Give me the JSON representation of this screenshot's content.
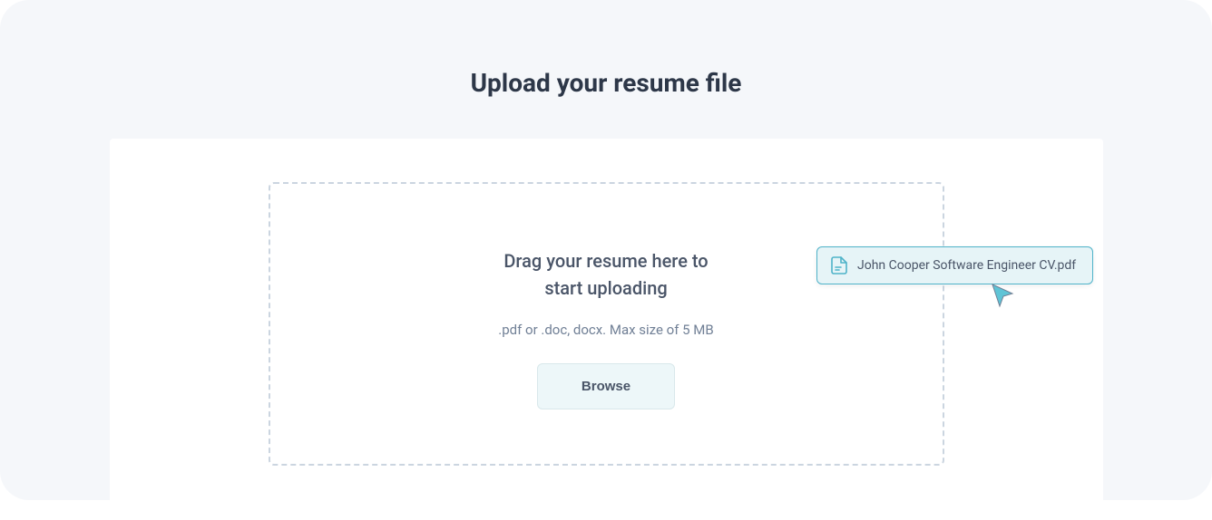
{
  "header": {
    "title": "Upload your resume file"
  },
  "dropzone": {
    "instruction_line1": "Drag your resume here to",
    "instruction_line2": "start uploading",
    "file_requirements": ".pdf or .doc, docx. Max size of 5 MB",
    "browse_label": "Browse"
  },
  "dragged_file": {
    "name": "John Cooper Software Engineer CV.pdf"
  }
}
